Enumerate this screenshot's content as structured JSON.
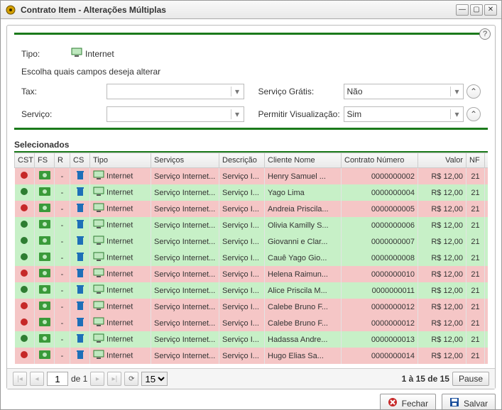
{
  "window": {
    "title": "Contrato Item - Alterações Múltiplas"
  },
  "help_icon": "?",
  "form": {
    "tipo_label": "Tipo:",
    "tipo_value": "Internet",
    "instruction": "Escolha quais campos deseja alterar",
    "tax_label": "Tax:",
    "servico_label": "Serviço:",
    "gratis_label": "Serviço Grátis:",
    "gratis_value": "Não",
    "visualizacao_label": "Permitir Visualização:",
    "visualizacao_value": "Sim"
  },
  "section_title": "Selecionados",
  "columns": {
    "cst": "CST",
    "fs": "FS",
    "r": "R",
    "cs": "CS",
    "tipo": "Tipo",
    "servicos": "Serviços",
    "descricao": "Descrição",
    "cliente": "Cliente Nome",
    "contrato": "Contrato Número",
    "valor": "Valor",
    "nf": "NF"
  },
  "rows": [
    {
      "row_class": "red",
      "dot": "rd",
      "r": "-",
      "tipo": "Internet",
      "serv": "Serviço Internet...",
      "desc": "Serviço I...",
      "cliente": "Henry Samuel ...",
      "contrato": "0000000002",
      "valor": "R$ 12,00",
      "nf": "21"
    },
    {
      "row_class": "green",
      "dot": "gn",
      "r": "-",
      "tipo": "Internet",
      "serv": "Serviço Internet...",
      "desc": "Serviço I...",
      "cliente": "Yago Lima",
      "contrato": "0000000004",
      "valor": "R$ 12,00",
      "nf": "21"
    },
    {
      "row_class": "red",
      "dot": "rd",
      "r": "-",
      "tipo": "Internet",
      "serv": "Serviço Internet...",
      "desc": "Serviço I...",
      "cliente": "Andreia Priscila...",
      "contrato": "0000000005",
      "valor": "R$ 12,00",
      "nf": "21"
    },
    {
      "row_class": "green",
      "dot": "gn",
      "r": "-",
      "tipo": "Internet",
      "serv": "Serviço Internet...",
      "desc": "Serviço I...",
      "cliente": "Olivia Kamilly S...",
      "contrato": "0000000006",
      "valor": "R$ 12,00",
      "nf": "21"
    },
    {
      "row_class": "green",
      "dot": "gn",
      "r": "-",
      "tipo": "Internet",
      "serv": "Serviço Internet...",
      "desc": "Serviço I...",
      "cliente": "Giovanni e Clar...",
      "contrato": "0000000007",
      "valor": "R$ 12,00",
      "nf": "21"
    },
    {
      "row_class": "green",
      "dot": "gn",
      "r": "-",
      "tipo": "Internet",
      "serv": "Serviço Internet...",
      "desc": "Serviço I...",
      "cliente": "Cauê Yago Gio...",
      "contrato": "0000000008",
      "valor": "R$ 12,00",
      "nf": "21"
    },
    {
      "row_class": "red",
      "dot": "rd",
      "r": "-",
      "tipo": "Internet",
      "serv": "Serviço Internet...",
      "desc": "Serviço I...",
      "cliente": "Helena Raimun...",
      "contrato": "0000000010",
      "valor": "R$ 12,00",
      "nf": "21"
    },
    {
      "row_class": "green",
      "dot": "gn",
      "r": "-",
      "tipo": "Internet",
      "serv": "Serviço Internet...",
      "desc": "Serviço I...",
      "cliente": "Alice Priscila M...",
      "contrato": "0000000011",
      "valor": "R$ 12,00",
      "nf": "21"
    },
    {
      "row_class": "red",
      "dot": "rd",
      "r": "-",
      "tipo": "Internet",
      "serv": "Serviço Internet...",
      "desc": "Serviço I...",
      "cliente": "Calebe Bruno F...",
      "contrato": "0000000012",
      "valor": "R$ 12,00",
      "nf": "21"
    },
    {
      "row_class": "red",
      "dot": "rd",
      "r": "-",
      "tipo": "Internet",
      "serv": "Serviço Internet...",
      "desc": "Serviço I...",
      "cliente": "Calebe Bruno F...",
      "contrato": "0000000012",
      "valor": "R$ 12,00",
      "nf": "21"
    },
    {
      "row_class": "green",
      "dot": "gn",
      "r": "-",
      "tipo": "Internet",
      "serv": "Serviço Internet...",
      "desc": "Serviço I...",
      "cliente": "Hadassa Andre...",
      "contrato": "0000000013",
      "valor": "R$ 12,00",
      "nf": "21"
    },
    {
      "row_class": "red",
      "dot": "rd",
      "r": "-",
      "tipo": "Internet",
      "serv": "Serviço Internet...",
      "desc": "Serviço I...",
      "cliente": "Hugo Elias Sa...",
      "contrato": "0000000014",
      "valor": "R$ 12,00",
      "nf": "21"
    }
  ],
  "pager": {
    "page": "1",
    "of": "de 1",
    "pagesize": "15",
    "summary": "1 à 15 de 15",
    "pause": "Pause"
  },
  "buttons": {
    "close": "Fechar",
    "save": "Salvar"
  }
}
